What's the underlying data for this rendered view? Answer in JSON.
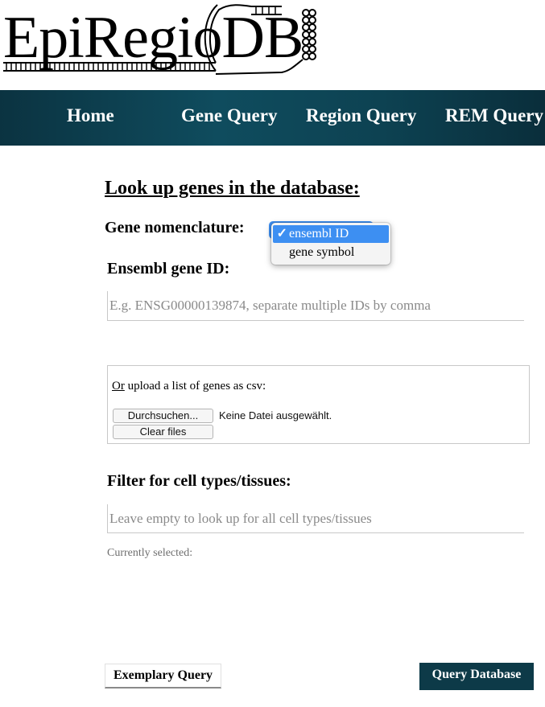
{
  "logo": {
    "text": "EpiRegio",
    "suffix": "DB"
  },
  "nav": {
    "items": [
      {
        "label": "Home"
      },
      {
        "label": "Gene Query"
      },
      {
        "label": "Region Query"
      },
      {
        "label": "REM Query"
      }
    ]
  },
  "form": {
    "title": "Look up genes in the database:",
    "nomenclature_label": "Gene nomenclature:",
    "nomenclature_options": [
      {
        "label": "ensembl ID",
        "selected": true
      },
      {
        "label": "gene symbol",
        "selected": false
      }
    ],
    "checkmark": "✓",
    "gene_id_label": "Ensembl gene ID:",
    "gene_id_placeholder": "E.g. ENSG00000139874, separate multiple IDs by comma",
    "gene_id_value": "",
    "upload": {
      "label_or": "Or",
      "label_rest": " upload a list of genes as csv:",
      "browse_label": "Durchsuchen...",
      "file_status": "Keine Datei ausgewählt.",
      "clear_label": "Clear files"
    },
    "filter_label": "Filter for cell types/tissues:",
    "filter_placeholder": "Leave empty to look up for all cell types/tissues",
    "filter_value": "",
    "currently_selected_label": "Currently selected:"
  },
  "buttons": {
    "exemplary_label": "Exemplary Query",
    "query_label": "Query Database"
  },
  "colors": {
    "nav_background": "#0f4c5e",
    "query_button": "#0d3a48",
    "selection_blue": "#3d8ff2"
  }
}
